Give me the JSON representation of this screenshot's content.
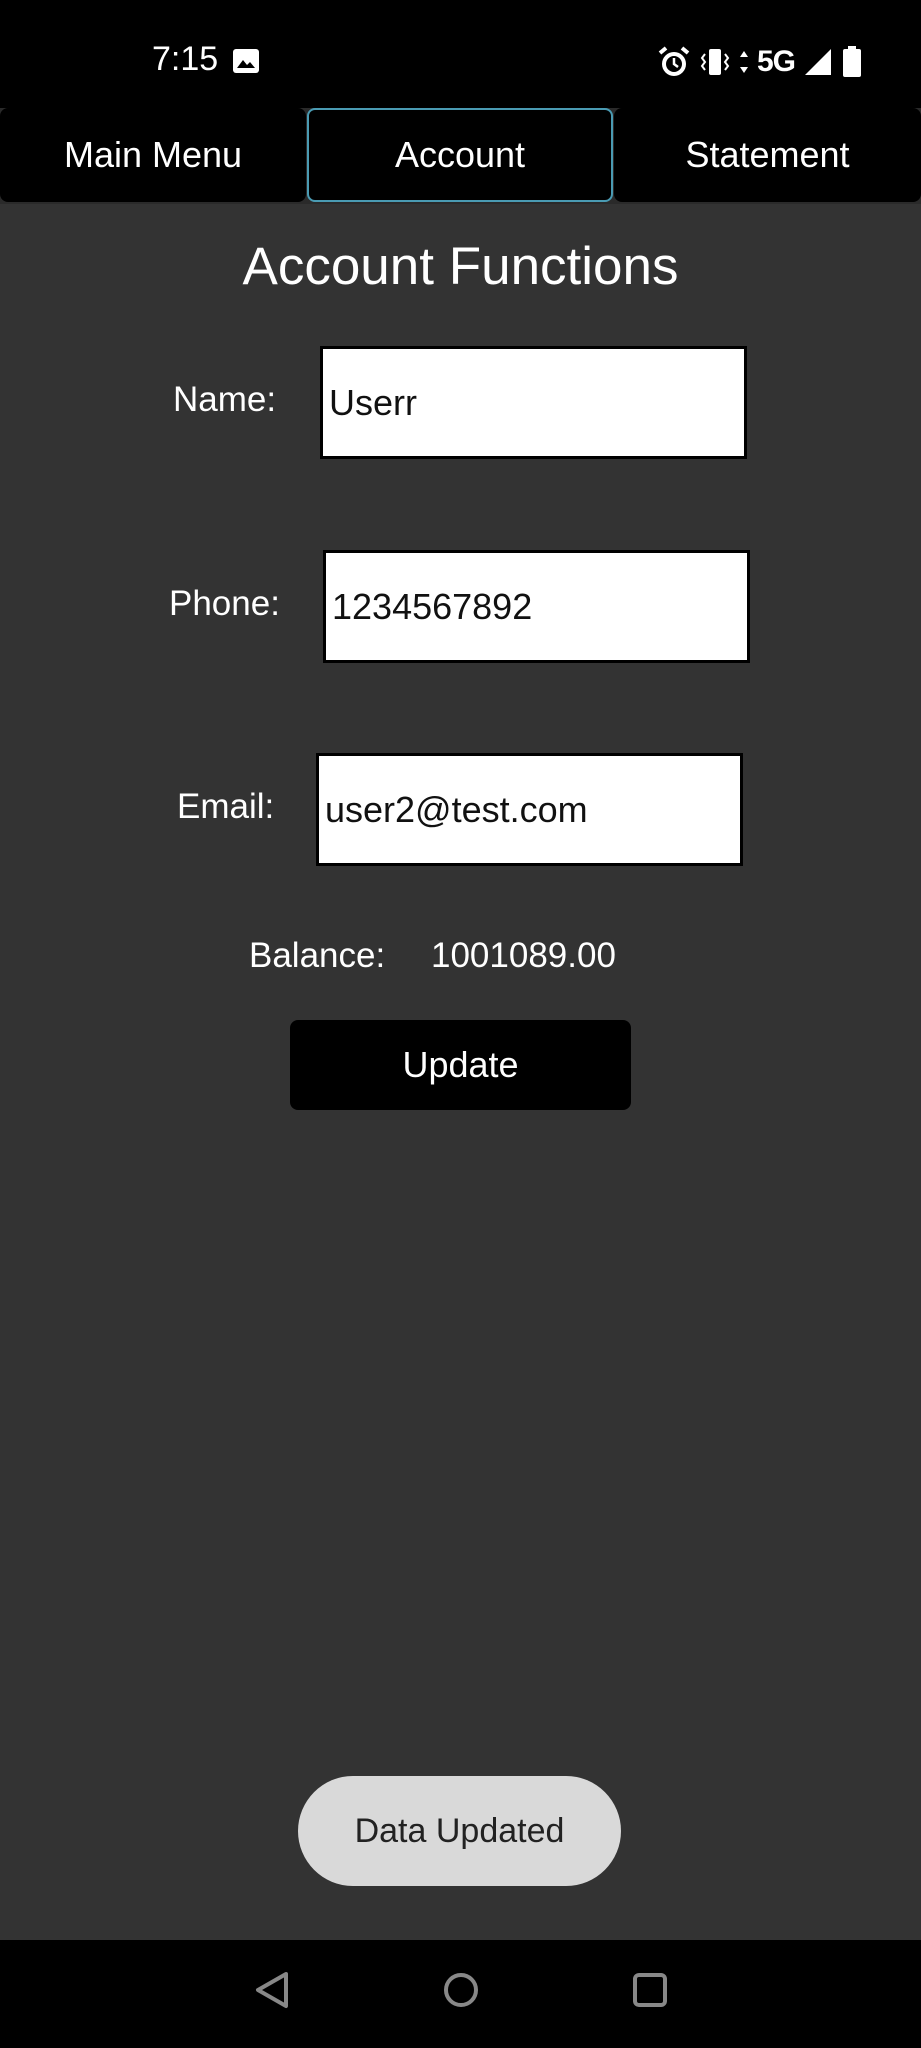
{
  "status_bar": {
    "time": "7:15",
    "network": "5G",
    "icons": [
      "image-icon",
      "alarm-icon",
      "vibrate-icon",
      "signal-icon",
      "battery-icon"
    ]
  },
  "tabs": [
    {
      "label": "Main Menu",
      "active": false
    },
    {
      "label": "Account",
      "active": true
    },
    {
      "label": "Statement",
      "active": false
    }
  ],
  "page": {
    "title": "Account Functions",
    "fields": {
      "name": {
        "label": "Name:",
        "value": "Userr"
      },
      "phone": {
        "label": "Phone:",
        "value": "1234567892"
      },
      "email": {
        "label": "Email:",
        "value": "user2@test.com"
      }
    },
    "balance": {
      "label": "Balance:",
      "value": "1001089.00"
    },
    "update_label": "Update"
  },
  "toast": {
    "message": "Data Updated"
  },
  "colors": {
    "background": "#333333",
    "tab_active_border": "#4a9bb3",
    "toast_bg": "#d9d9d9"
  },
  "nav_bar": {
    "icons": [
      "back-icon",
      "home-icon",
      "recents-icon"
    ]
  }
}
